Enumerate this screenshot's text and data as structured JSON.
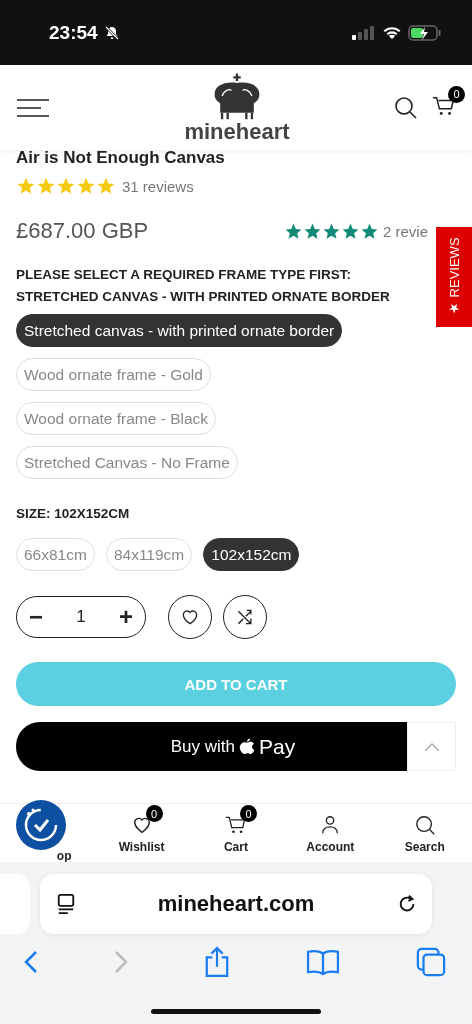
{
  "status_bar": {
    "time": "23:54"
  },
  "header": {
    "logo": "mineheart",
    "cart_count": "0"
  },
  "product": {
    "title": "Air is Not Enough Canvas",
    "stars": 5,
    "reviews": "31 reviews",
    "price": "£687.00 GBP"
  },
  "store_rating": {
    "stars": 5,
    "reviews": "2 revie"
  },
  "reviews_tab": {
    "label": "★ REVIEWS"
  },
  "frame": {
    "heading": "PLEASE SELECT A REQUIRED FRAME TYPE FIRST: STRETCHED CANVAS - WITH PRINTED ORNATE BORDER",
    "options": [
      {
        "label": "Stretched canvas - with printed ornate border",
        "selected": true
      },
      {
        "label": "Wood ornate frame - Gold",
        "selected": false
      },
      {
        "label": "Wood ornate frame - Black",
        "selected": false
      },
      {
        "label": "Stretched Canvas - No Frame",
        "selected": false
      }
    ]
  },
  "size": {
    "heading": "SIZE: 102X152CM",
    "options": [
      {
        "label": "66x81cm",
        "selected": false
      },
      {
        "label": "84x119cm",
        "selected": false
      },
      {
        "label": "102x152cm",
        "selected": true
      }
    ]
  },
  "quantity": {
    "minus": "−",
    "value": "1",
    "plus": "+"
  },
  "add_to_cart": "ADD TO CART",
  "buy_button": {
    "before": "Buy with",
    "after": "Pay"
  },
  "bottom_nav": [
    {
      "kind": "shop",
      "label": "op"
    },
    {
      "kind": "wishlist",
      "label": "Wishlist",
      "badge": "0"
    },
    {
      "kind": "cart",
      "label": "Cart",
      "badge": "0"
    },
    {
      "kind": "account",
      "label": "Account"
    },
    {
      "kind": "search",
      "label": "Search"
    }
  ],
  "browser": {
    "url": "mineheart.com",
    "back_disabled": false,
    "forward_disabled": true
  }
}
